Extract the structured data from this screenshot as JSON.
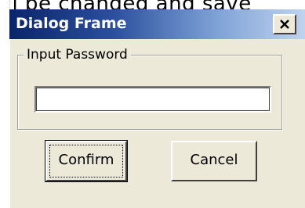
{
  "background": {
    "text": "ill be changed and save"
  },
  "dialog": {
    "title": "Dialog Frame",
    "close_icon": "close-x-icon",
    "group_label": "Input Password",
    "password_value": "",
    "buttons": {
      "confirm": "Confirm",
      "cancel": "Cancel"
    }
  },
  "colors": {
    "title_gradient_start": "#0a246a",
    "title_gradient_end": "#c0d3ee",
    "dialog_face": "#ece9d8",
    "title_text": "#ffffff"
  }
}
